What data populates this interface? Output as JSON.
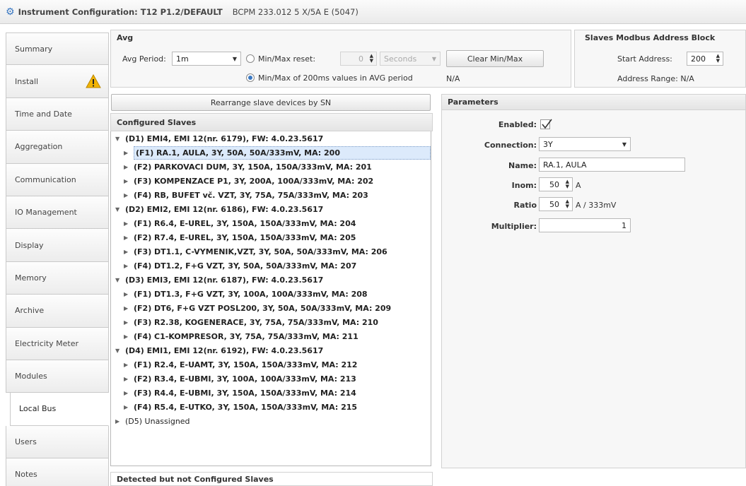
{
  "window": {
    "title": "Instrument Configuration: T12 P1.2/DEFAULT",
    "device": "BCPM 233.012 5 X/5A E (5047)"
  },
  "sidebar": {
    "items": [
      {
        "label": "Summary"
      },
      {
        "label": "Install",
        "warning": true
      },
      {
        "label": "Time and Date"
      },
      {
        "label": "Aggregation"
      },
      {
        "label": "Communication"
      },
      {
        "label": "IO Management"
      },
      {
        "label": "Display"
      },
      {
        "label": "Memory"
      },
      {
        "label": "Archive"
      },
      {
        "label": "Electricity Meter"
      },
      {
        "label": "Modules"
      },
      {
        "label": "Local Bus",
        "active": true
      },
      {
        "label": "Users"
      },
      {
        "label": "Notes"
      }
    ]
  },
  "avg": {
    "title": "Avg",
    "period_label": "Avg Period:",
    "period_value": "1m",
    "minmax_reset_label": "Min/Max reset:",
    "reset_value": "0",
    "reset_unit": "Seconds",
    "clear_button": "Clear Min/Max",
    "minmax_200ms_label": "Min/Max of 200ms values in AVG period",
    "na": "N/A"
  },
  "address_block": {
    "title": "Slaves Modbus Address Block",
    "start_label": "Start Address:",
    "start_value": "200",
    "range_label": "Address Range: N/A"
  },
  "rearrange_button": "Rearrange slave devices by SN",
  "configured": {
    "title": "Configured Slaves",
    "tree": [
      {
        "level": 0,
        "text": "(D1) EMI4, EMI 12(nr. 6179), FW: 4.0.23.5617",
        "expanded": true
      },
      {
        "level": 1,
        "text": "(F1) RA.1, AULA, 3Y, 50A, 50A/333mV, MA: 200",
        "selected": true
      },
      {
        "level": 1,
        "text": "(F2) PARKOVACI DUM, 3Y, 150A, 150A/333mV, MA: 201"
      },
      {
        "level": 1,
        "text": "(F3) KOMPENZACE P1, 3Y, 200A, 100A/333mV, MA: 202"
      },
      {
        "level": 1,
        "text": "(F4) RB, BUFET vč. VZT, 3Y, 75A, 75A/333mV, MA: 203"
      },
      {
        "level": 0,
        "text": "(D2) EMI2, EMI 12(nr. 6186), FW: 4.0.23.5617",
        "expanded": true
      },
      {
        "level": 1,
        "text": "(F1) R6.4, E-UREL, 3Y, 150A, 150A/333mV, MA: 204"
      },
      {
        "level": 1,
        "text": "(F2) R7.4, E-UREL, 3Y, 150A, 150A/333mV, MA: 205"
      },
      {
        "level": 1,
        "text": "(F3) DT1.1, C-VYMENIK,VZT, 3Y, 50A, 50A/333mV, MA: 206"
      },
      {
        "level": 1,
        "text": "(F4) DT1.2, F+G VZT, 3Y, 50A, 50A/333mV, MA: 207"
      },
      {
        "level": 0,
        "text": "(D3) EMI3, EMI 12(nr. 6187), FW: 4.0.23.5617",
        "expanded": true
      },
      {
        "level": 1,
        "text": "(F1) DT1.3, F+G VZT, 3Y, 100A, 100A/333mV, MA: 208"
      },
      {
        "level": 1,
        "text": "(F2) DT6, F+G VZT POSL200, 3Y, 50A, 50A/333mV, MA: 209"
      },
      {
        "level": 1,
        "text": "(F3) R2.38, KOGENERACE, 3Y, 75A, 75A/333mV, MA: 210"
      },
      {
        "level": 1,
        "text": "(F4) C1-KOMPRESOR, 3Y, 75A, 75A/333mV, MA: 211"
      },
      {
        "level": 0,
        "text": "(D4) EMI1, EMI 12(nr. 6192), FW: 4.0.23.5617",
        "expanded": true
      },
      {
        "level": 1,
        "text": "(F1) R2.4, E-UAMT, 3Y, 150A, 150A/333mV, MA: 212"
      },
      {
        "level": 1,
        "text": "(F2) R3.4, E-UBMI, 3Y, 100A, 100A/333mV, MA: 213"
      },
      {
        "level": 1,
        "text": "(F3) R4.4, E-UBMI, 3Y, 150A, 150A/333mV, MA: 214"
      },
      {
        "level": 1,
        "text": "(F4) R5.4, E-UTKO, 3Y, 150A, 150A/333mV, MA: 215"
      },
      {
        "level": 0,
        "text": "(D5) Unassigned",
        "expanded": false,
        "plain": true
      }
    ]
  },
  "parameters": {
    "title": "Parameters",
    "enabled_label": "Enabled:",
    "enabled": true,
    "connection_label": "Connection:",
    "connection_value": "3Y",
    "name_label": "Name:",
    "name_value": "RA.1, AULA",
    "inom_label": "Inom:",
    "inom_value": "50",
    "inom_unit": "A",
    "ratio_label": "Ratio",
    "ratio_value": "50",
    "ratio_unit": "A / 333mV",
    "multiplier_label": "Multiplier:",
    "multiplier_value": "1"
  },
  "detected": {
    "title": "Detected but not Configured Slaves"
  },
  "colors": {
    "accent": "#3a78c2",
    "warning": "#f2b400",
    "selection": "#dceafb"
  }
}
